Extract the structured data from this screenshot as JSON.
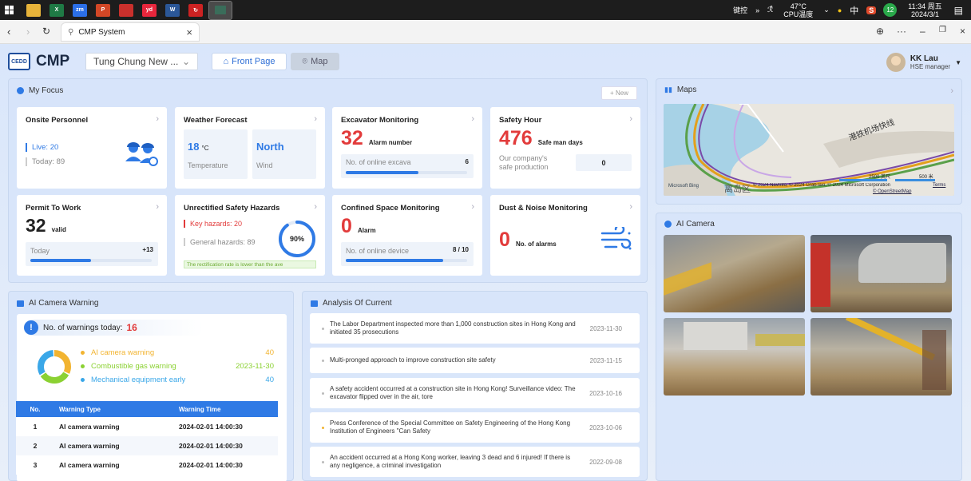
{
  "taskbar": {
    "apps": [
      {
        "icon": "folder-icon",
        "color": "#e8b43a",
        "text": ""
      },
      {
        "icon": "excel-icon",
        "color": "#1f7a45",
        "text": "X"
      },
      {
        "icon": "zoom-icon",
        "color": "#2b6fe8",
        "text": "zm"
      },
      {
        "icon": "powerpoint-icon",
        "color": "#d24726",
        "text": "P"
      },
      {
        "icon": "pdf-icon",
        "color": "#c9302c",
        "text": ""
      },
      {
        "icon": "youdao-icon",
        "color": "#e8263c",
        "text": "yd"
      },
      {
        "icon": "word-icon",
        "color": "#2b5797",
        "text": "W"
      },
      {
        "icon": "refresh-app-icon",
        "color": "#cc2222",
        "text": "↻"
      },
      {
        "icon": "terminal-icon",
        "color": "#3a6d5a",
        "text": ""
      }
    ],
    "tray_label": "键控",
    "temp": "47°C",
    "temp_label": "CPU温度",
    "lang": "中",
    "badge": "12",
    "time": "11:34 周五",
    "date": "2024/3/1"
  },
  "browser": {
    "tab_title": "CMP System"
  },
  "header": {
    "logo_text": "CEDD",
    "brand": "CMP",
    "site": "Tung Chung New ...",
    "front_page": "Front Page",
    "map": "Map",
    "user_name": "KK Lau",
    "user_role": "HSE manager"
  },
  "focus": {
    "title": "My Focus",
    "new_label": "+ New",
    "onsite": {
      "title": "Onsite Personnel",
      "live": "Live: 20",
      "today": "Today: 89"
    },
    "weather": {
      "title": "Weather Forecast",
      "temp": "18",
      "temp_unit": "°C",
      "temp_label": "Temperature",
      "wind": "North",
      "wind_label": "Wind"
    },
    "excavator": {
      "title": "Excavator Monitoring",
      "alarm": "32",
      "alarm_label": "Alarm number",
      "online_label": "No. of online excava",
      "online_value": "6",
      "progress": 0.6
    },
    "safety": {
      "title": "Safety Hour",
      "value": "476",
      "value_label": "Safe man days",
      "prod_label": "Our company's safe production",
      "prod_value": "0"
    },
    "permit": {
      "title": "Permit To Work",
      "value": "32",
      "value_label": "valid",
      "today_label": "Today",
      "today_value": "+13",
      "progress": 0.5
    },
    "hazards": {
      "title": "Unrectified Safety Hazards",
      "key": "Key hazards: 20",
      "general": "General hazards:  89",
      "percent": "90%",
      "percent_value": 90,
      "note": "The rectification rate is lower than the ave"
    },
    "confined": {
      "title": "Confined Space Monitoring",
      "alarm": "0",
      "alarm_label": "Alarm",
      "online_label": "No. of online device",
      "online_value": "8 / 10",
      "progress": 0.8
    },
    "dust": {
      "title": "Dust & Noise Monitoring",
      "alarm": "0",
      "alarm_label": "No. of alarms"
    }
  },
  "warning": {
    "title": "AI Camera Warning",
    "count_label": "No. of warnings today:",
    "count": "16",
    "legend": [
      {
        "label": "AI camera warning",
        "value": "40",
        "color": "#f2b431"
      },
      {
        "label": "Combustible gas warning",
        "value": "2023-11-30",
        "color": "#8bd132"
      },
      {
        "label": "Mechanical equipment early",
        "value": "40",
        "color": "#3aa7e8"
      }
    ],
    "table_headers": [
      "No.",
      "Warning Type",
      "Warning Time"
    ],
    "rows": [
      [
        "1",
        "AI camera warning",
        "2024-02-01 14:00:30"
      ],
      [
        "2",
        "AI camera warning",
        "2024-02-01 14:00:30"
      ],
      [
        "3",
        "AI camera warning",
        "2024-02-01 14:00:30"
      ]
    ]
  },
  "analysis": {
    "title": "Analysis Of Current",
    "items": [
      {
        "text": "The Labor Department inspected more than 1,000 construction sites in Hong Kong and initiated 35 prosecutions",
        "date": "2023-11-30",
        "bullet": "#bbbbbb"
      },
      {
        "text": "Multi-pronged approach to improve construction site safety",
        "date": "2023-11-15",
        "bullet": "#bbbbbb"
      },
      {
        "text": "A safety accident occurred at a construction site in Hong Kong! Surveillance video: The excavator flipped over in the air, tore",
        "date": "2023-10-16",
        "bullet": "#bbbbbb"
      },
      {
        "text": "Press Conference of the Special Committee on Safety Engineering of the Hong Kong Institution of Engineers \"Can Safety",
        "date": "2023-10-06",
        "bullet": "#f2b431"
      },
      {
        "text": "An accident occurred at a Hong Kong worker, leaving 3 dead and 6 injured! If there is any negligence, a criminal investigation",
        "date": "2022-09-08",
        "bullet": "#bbbbbb"
      }
    ]
  },
  "maps": {
    "title": "Maps",
    "area_label": "离岛区",
    "road_label": "港铁机场快线",
    "scale_a": "2500 英尺",
    "scale_b": "500 米",
    "credit": "© 2024 NavInfo, © 2024 GrabTaxi, © 2024 Microsoft Corporation",
    "terms": "Terms",
    "osm": "© OpenStreetMap",
    "bing": "Microsoft Bing"
  },
  "camera": {
    "title": "AI Camera"
  }
}
